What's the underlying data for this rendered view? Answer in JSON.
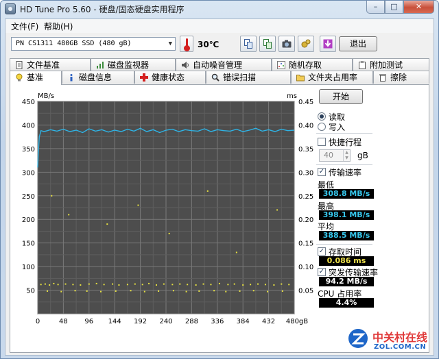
{
  "window": {
    "title": "HD Tune Pro 5.60 - 硬盘/固态硬盘实用程序",
    "minimize": "–",
    "maximize": "□",
    "close": "✕"
  },
  "menu": {
    "file": "文件(F)",
    "help": "帮助(H)"
  },
  "toolbar": {
    "drive": "PN    CS1311 480GB SSD (480 gB)",
    "temperature": "30℃",
    "exit_label": "退出"
  },
  "tabs_top": [
    "文件基准",
    "磁盘监视器",
    "自动噪音管理",
    "随机存取",
    "附加测试"
  ],
  "tabs_bottom": [
    "基准",
    "磁盘信息",
    "健康状态",
    "错误扫描",
    "文件夹占用率",
    "擦除"
  ],
  "panel": {
    "start_label": "开始",
    "read_label": "读取",
    "write_label": "写入",
    "short_stroke_label": "快捷行程",
    "short_stroke_value": "40",
    "short_stroke_unit": "gB",
    "transfer_rate_label": "传输速率",
    "min_label": "最低",
    "min_value": "308.8 MB/s",
    "max_label": "最高",
    "max_value": "398.1 MB/s",
    "avg_label": "平均",
    "avg_value": "388.5 MB/s",
    "access_time_label": "存取时间",
    "access_time_value": "0.086 ms",
    "burst_label": "突发传输速率",
    "burst_value": "94.2 MB/s",
    "cpu_label": "CPU 占用率",
    "cpu_value": "4.4%"
  },
  "chart_data": {
    "type": "line",
    "left_unit": "MB/s",
    "right_unit": "ms",
    "x_ticks": [
      "0",
      "48",
      "96",
      "144",
      "192",
      "240",
      "288",
      "336",
      "384",
      "432",
      "480gB"
    ],
    "y_left_ticks": [
      "450",
      "400",
      "350",
      "300",
      "250",
      "200",
      "150",
      "100",
      "50"
    ],
    "y_right_ticks": [
      "0.45",
      "0.40",
      "0.35",
      "0.30",
      "0.25",
      "0.20",
      "0.15",
      "0.10",
      "0.05"
    ],
    "xlim": [
      0,
      480
    ],
    "ylim_left": [
      0,
      450
    ],
    "ylim_right": [
      0,
      0.45
    ],
    "series": [
      {
        "kind": "transfer",
        "color": "#2fb4e6",
        "x": [
          0,
          1,
          3,
          6,
          12,
          24,
          36,
          48,
          60,
          72,
          84,
          96,
          108,
          120,
          132,
          144,
          156,
          168,
          180,
          192,
          204,
          216,
          228,
          240,
          252,
          264,
          276,
          288,
          300,
          312,
          324,
          336,
          348,
          360,
          372,
          384,
          396,
          408,
          420,
          432,
          444,
          456,
          468,
          480
        ],
        "y": [
          310,
          340,
          375,
          388,
          386,
          390,
          387,
          391,
          386,
          389,
          384,
          392,
          387,
          390,
          385,
          389,
          386,
          391,
          387,
          393,
          386,
          390,
          384,
          389,
          391,
          386,
          390,
          388,
          387,
          392,
          386,
          390,
          388,
          387,
          391,
          386,
          389,
          393,
          387,
          390,
          386,
          391,
          388,
          389
        ]
      },
      {
        "kind": "access",
        "color": "#e6e040",
        "x": [
          6,
          14,
          22,
          30,
          38,
          52,
          66,
          80,
          96,
          110,
          124,
          140,
          152,
          168,
          182,
          196,
          208,
          222,
          236,
          252,
          266,
          280,
          296,
          310,
          324,
          340,
          356,
          368,
          384,
          398,
          412,
          426,
          442,
          456,
          470,
          18,
          44,
          70,
          92,
          118,
          146,
          174,
          200,
          226,
          254,
          278,
          302,
          330,
          352,
          378,
          404,
          430,
          458,
          26,
          58,
          130,
          188,
          246,
          318,
          372,
          448
        ],
        "y": [
          0.062,
          0.063,
          0.061,
          0.064,
          0.062,
          0.063,
          0.062,
          0.061,
          0.063,
          0.064,
          0.062,
          0.063,
          0.061,
          0.062,
          0.063,
          0.062,
          0.064,
          0.061,
          0.063,
          0.062,
          0.063,
          0.062,
          0.061,
          0.063,
          0.062,
          0.064,
          0.062,
          0.063,
          0.061,
          0.062,
          0.063,
          0.062,
          0.061,
          0.063,
          0.062,
          0.048,
          0.047,
          0.049,
          0.048,
          0.047,
          0.048,
          0.049,
          0.047,
          0.048,
          0.049,
          0.047,
          0.048,
          0.049,
          0.047,
          0.048,
          0.049,
          0.047,
          0.048,
          0.25,
          0.21,
          0.19,
          0.23,
          0.17,
          0.26,
          0.13,
          0.22
        ]
      }
    ]
  },
  "watermark": {
    "cn": "中关村在线",
    "en": "ZOL.COM.CN"
  }
}
